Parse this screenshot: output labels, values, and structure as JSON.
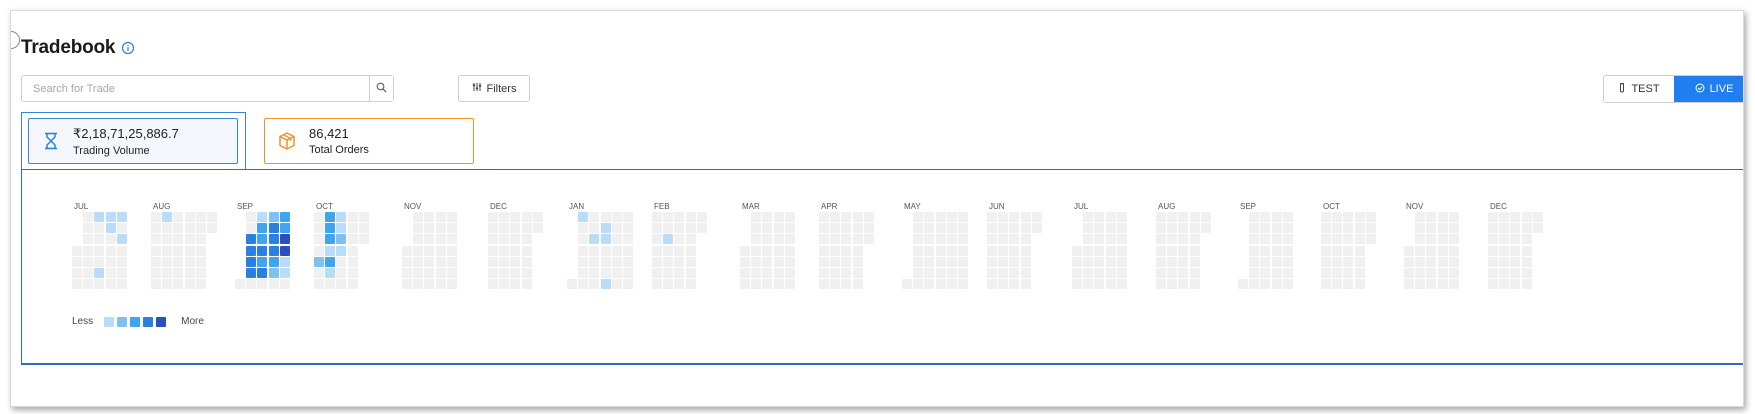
{
  "page": {
    "title": "Tradebook"
  },
  "search": {
    "placeholder": "Search for Trade"
  },
  "toolbar": {
    "filters_label": "Filters"
  },
  "mode": {
    "test_label": "TEST",
    "live_label": "LIVE",
    "active": "LIVE"
  },
  "stats": {
    "volume": {
      "value": "₹2,18,71,25,886.7",
      "label": "Trading Volume"
    },
    "orders": {
      "value": "86,421",
      "label": "Total Orders"
    }
  },
  "heatmap": {
    "months": [
      "JUL",
      "AUG",
      "SEP",
      "OCT",
      "NOV",
      "DEC",
      "JAN",
      "FEB",
      "MAR",
      "APR",
      "MAY",
      "JUN",
      "JUL",
      "AUG",
      "SEP",
      "OCT",
      "NOV",
      "DEC"
    ],
    "legend": {
      "less": "Less",
      "more": "More"
    },
    "colors": {
      "empty": "#f0f0f0",
      "levels": [
        "#b9dcf9",
        "#7fc0f3",
        "#3ea5ee",
        "#2a7fe0",
        "#2f4dbf"
      ]
    }
  },
  "colors": {
    "accent": "#1f7ef0",
    "volume_border": "#3a86d6",
    "orders_border": "#f0922b"
  },
  "icons": {
    "info": "info-icon",
    "search": "search-icon",
    "filters": "filter-icon",
    "test": "flask-icon",
    "live": "check-circle-icon",
    "volume": "hourglass-icon",
    "orders": "box-icon"
  }
}
